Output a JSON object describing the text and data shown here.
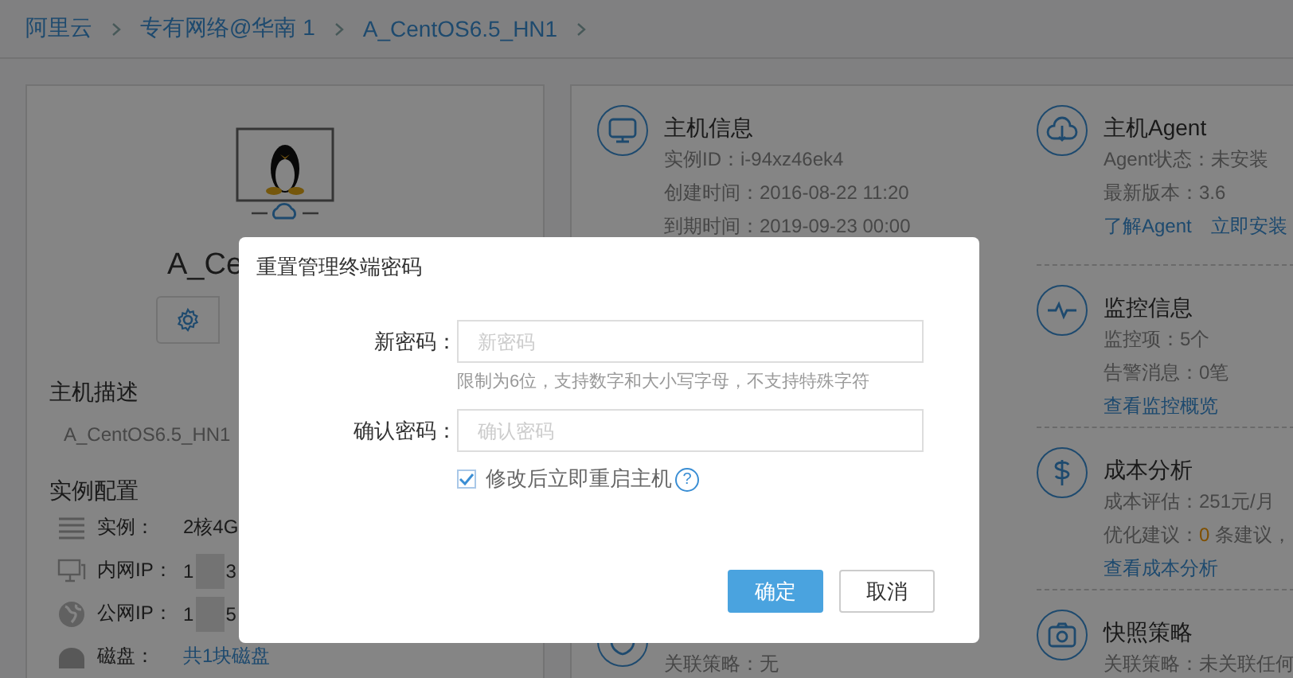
{
  "breadcrumb": [
    "阿里云",
    "专有网络@华南 1",
    "A_CentOS6.5_HN1"
  ],
  "host": {
    "name": "A_Ce",
    "description_title": "主机描述",
    "description": "A_CentOS6.5_HN1",
    "config_title": "实例配置",
    "config_rows": [
      {
        "kind": "plain",
        "label": "实例：",
        "value": "2核4G"
      },
      {
        "kind": "redacted",
        "label": "内网IP：",
        "value_start": "1",
        "value_end": "3"
      },
      {
        "kind": "redacted",
        "label": "公网IP：",
        "value_start": "1",
        "value_end": "5"
      },
      {
        "kind": "link",
        "label": "磁盘：",
        "value": "共1块磁盘"
      }
    ]
  },
  "info_columns": [
    {
      "sections": [
        {
          "title": "主机信息",
          "lines": [
            {
              "kind": "text",
              "text": "实例ID：i-94xz46ek4"
            },
            {
              "kind": "text",
              "text": "创建时间：2016-08-22 11:20"
            },
            {
              "kind": "text",
              "text": "到期时间：2019-09-23 00:00"
            }
          ]
        },
        {
          "lines": [
            {
              "kind": "text",
              "text": "关联策略：无"
            }
          ]
        }
      ]
    },
    {
      "sections": [
        {
          "title": "主机Agent",
          "lines": [
            {
              "kind": "text",
              "text": "Agent状态：未安装"
            },
            {
              "kind": "text",
              "text": "最新版本：3.6"
            },
            {
              "kind": "links",
              "links": [
                "了解Agent",
                "立即安装"
              ]
            }
          ]
        },
        {
          "title": "监控信息",
          "lines": [
            {
              "kind": "text",
              "text": "监控项：5个"
            },
            {
              "kind": "text",
              "text": "告警消息：0笔"
            },
            {
              "kind": "links",
              "links": [
                "查看监控概览"
              ]
            }
          ]
        },
        {
          "title": "成本分析",
          "lines": [
            {
              "kind": "text",
              "text": "成本评估：251元/月"
            },
            {
              "kind": "accent",
              "before": "优化建议：",
              "accent": "0",
              "after": " 条建议，"
            },
            {
              "kind": "links",
              "links": [
                "查看成本分析"
              ]
            }
          ]
        },
        {
          "title": "快照策略",
          "lines": [
            {
              "kind": "text",
              "text": "关联策略：未关联任何"
            }
          ]
        }
      ]
    }
  ],
  "dialog": {
    "title": "重置管理终端密码",
    "fields": [
      {
        "label": "新密码：",
        "placeholder": "新密码",
        "hint": "限制为6位，支持数字和大小写字母，不支持特殊字符"
      },
      {
        "label": "确认密码：",
        "placeholder": "确认密码"
      }
    ],
    "checkbox": {
      "label": "修改后立即重启主机",
      "checked": true,
      "help": "?"
    },
    "buttons": [
      {
        "kind": "primary",
        "label": "确定"
      },
      {
        "kind": "secondary",
        "label": "取消"
      }
    ]
  }
}
